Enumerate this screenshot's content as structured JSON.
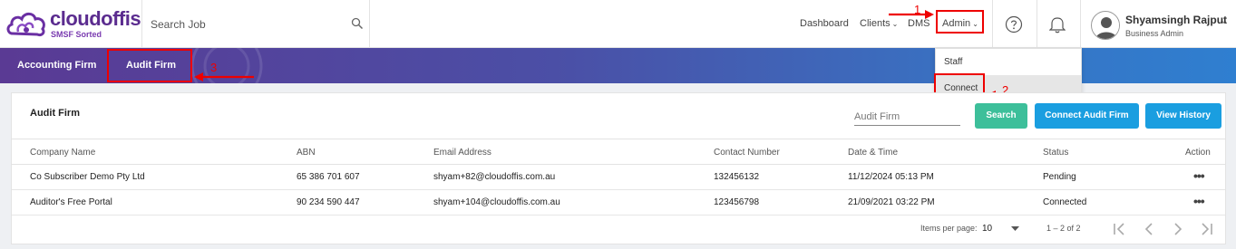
{
  "brand": {
    "name": "cloudoffis",
    "tagline": "SMSF Sorted",
    "color": "#5b2c8f"
  },
  "search": {
    "placeholder": "Search Job"
  },
  "nav": {
    "dashboard": "Dashboard",
    "clients": "Clients",
    "dms": "DMS",
    "admin": "Admin"
  },
  "user": {
    "name": "Shyamsingh Rajput",
    "role": "Business Admin"
  },
  "tabs": [
    {
      "label": "Accounting Firm"
    },
    {
      "label": "Audit Firm"
    }
  ],
  "admin_menu": [
    {
      "label": "Staff"
    },
    {
      "label": "Connect"
    }
  ],
  "annotations": {
    "step1": "1",
    "step2": "2",
    "step3": "3"
  },
  "card": {
    "title": "Audit Firm",
    "filter_placeholder": "Audit Firm",
    "search_button": "Search",
    "connect_button": "Connect Audit Firm",
    "history_button": "View History"
  },
  "table": {
    "columns": [
      "Company Name",
      "ABN",
      "Email Address",
      "Contact Number",
      "Date & Time",
      "Status",
      "Action"
    ],
    "rows": [
      {
        "company": "Co Subscriber Demo Pty Ltd",
        "abn": "65 386 701 607",
        "email": "shyam+82@cloudoffis.com.au",
        "contact": "132456132",
        "datetime": "11/12/2024 05:13 PM",
        "status": "Pending",
        "action": "•••"
      },
      {
        "company": "Auditor's Free Portal",
        "abn": "90 234 590 447",
        "email": "shyam+104@cloudoffis.com.au",
        "contact": "123456798",
        "datetime": "21/09/2021 03:22 PM",
        "status": "Connected",
        "action": "•••"
      }
    ]
  },
  "pagination": {
    "items_per_page_label": "Items per page:",
    "items_per_page": "10",
    "range": "1 – 2 of 2"
  },
  "colors": {
    "accent": "#1a9ee0",
    "search_button": "#3dbf9a",
    "annotation": "#ee0000"
  }
}
